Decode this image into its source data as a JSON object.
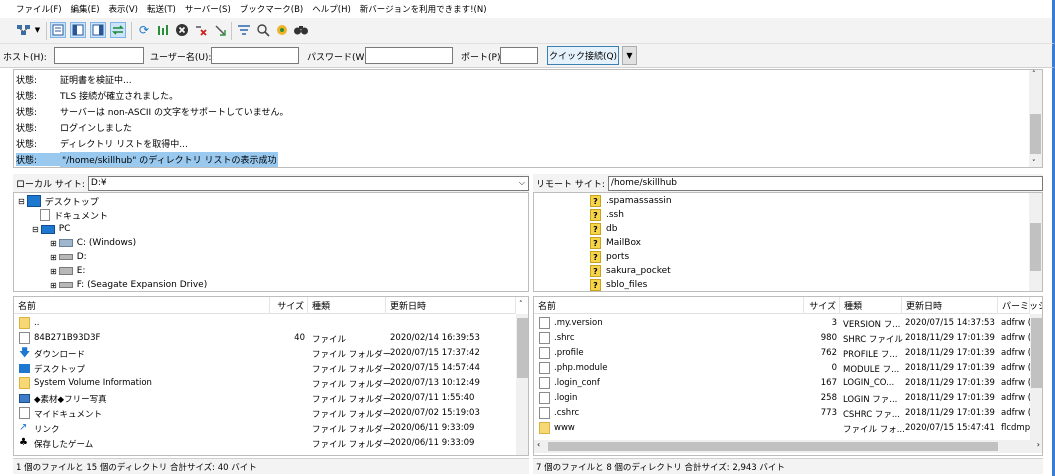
{
  "menu": [
    "ファイル(F)",
    "編集(E)",
    "表示(V)",
    "転送(T)",
    "サーバー(S)",
    "ブックマーク(B)",
    "ヘルプ(H)",
    "新バージョンを利用できます!(N)"
  ],
  "quickconnect": {
    "host_label": "ホスト(H):",
    "user_label": "ユーザー名(U):",
    "pass_label": "パスワード(W):",
    "port_label": "ポート(P):",
    "button": "クイック接続(Q)",
    "dropdown": "▼"
  },
  "log": {
    "rows": [
      {
        "k": "状態:",
        "v": "証明書を検証中..."
      },
      {
        "k": "状態:",
        "v": "TLS 接続が確立されました。"
      },
      {
        "k": "状態:",
        "v": "サーバーは non-ASCII の文字をサポートしていません。"
      },
      {
        "k": "状態:",
        "v": "ログインしました"
      },
      {
        "k": "状態:",
        "v": "ディレクトリ リストを取得中..."
      },
      {
        "k": "状態:",
        "v": "\"/home/skillhub\" のディレクトリ リストの表示成功"
      }
    ]
  },
  "local": {
    "site_label": "ローカル サイト:",
    "site_path": "D:¥",
    "tree": [
      {
        "label": "デスクトップ",
        "icon": "desktop-icon"
      },
      {
        "label": "ドキュメント",
        "icon": "document-icon"
      },
      {
        "label": "PC",
        "icon": "pc-icon"
      },
      {
        "label": "C: (Windows)",
        "icon": "drive-icon"
      },
      {
        "label": "D:",
        "icon": "drive-icon"
      },
      {
        "label": "E:",
        "icon": "drive-icon"
      },
      {
        "label": "F: (Seagate Expansion Drive)",
        "icon": "drive-icon"
      }
    ],
    "columns": [
      "名前",
      "サイズ",
      "種類",
      "更新日時"
    ],
    "rows": [
      {
        "name": "..",
        "size": "",
        "type": "",
        "date": "",
        "icon": "folder"
      },
      {
        "name": "84B271B93D3F",
        "size": "40",
        "type": "ファイル",
        "date": "2020/02/14 16:39:53",
        "icon": "file"
      },
      {
        "name": "ダウンロード",
        "size": "",
        "type": "ファイル フォルダー",
        "date": "2020/07/15 17:37:42",
        "icon": "download"
      },
      {
        "name": "デスクトップ",
        "size": "",
        "type": "ファイル フォルダー",
        "date": "2020/07/15 14:57:44",
        "icon": "desktop"
      },
      {
        "name": "System Volume Information",
        "size": "",
        "type": "ファイル フォルダー",
        "date": "2020/07/13 10:12:49",
        "icon": "folder"
      },
      {
        "name": "◆素材◆フリー写真",
        "size": "",
        "type": "ファイル フォルダー",
        "date": "2020/07/11 1:55:40",
        "icon": "folder"
      },
      {
        "name": "マイドキュメント",
        "size": "",
        "type": "ファイル フォルダー",
        "date": "2020/07/02 15:19:03",
        "icon": "document"
      },
      {
        "name": "リンク",
        "size": "",
        "type": "ファイル フォルダー",
        "date": "2020/06/11 9:33:09",
        "icon": "link"
      },
      {
        "name": "保存したゲーム",
        "size": "",
        "type": "ファイル フォルダー",
        "date": "2020/06/11 9:33:09",
        "icon": "game"
      }
    ],
    "status": "1 個のファイルと 15 個のディレクトリ 合計サイズ: 40 バイト"
  },
  "remote": {
    "site_label": "リモート サイト:",
    "site_path": "/home/skillhub",
    "tree": [
      ".spamassassin",
      ".ssh",
      "db",
      "MailBox",
      "ports",
      "sakura_pocket",
      "sblo_files"
    ],
    "columns": [
      "名前",
      "サイズ",
      "種類",
      "更新日時",
      "パーミッシ"
    ],
    "rows": [
      {
        "name": ".my.version",
        "size": "3",
        "type": "VERSION フ...",
        "date": "2020/07/15 14:37:53",
        "perm": "adfrw (",
        "icon": "file"
      },
      {
        "name": ".shrc",
        "size": "980",
        "type": "SHRC ファイル",
        "date": "2018/11/29 17:01:39",
        "perm": "adfrw (",
        "icon": "file"
      },
      {
        "name": ".profile",
        "size": "762",
        "type": "PROFILE フ...",
        "date": "2018/11/29 17:01:39",
        "perm": "adfrw (",
        "icon": "file"
      },
      {
        "name": ".php.module",
        "size": "0",
        "type": "MODULE フ...",
        "date": "2018/11/29 17:01:39",
        "perm": "adfrw (",
        "icon": "file"
      },
      {
        "name": ".login_conf",
        "size": "167",
        "type": "LOGIN_CO...",
        "date": "2018/11/29 17:01:39",
        "perm": "adfrw (",
        "icon": "file"
      },
      {
        "name": ".login",
        "size": "258",
        "type": "LOGIN ファ...",
        "date": "2018/11/29 17:01:39",
        "perm": "adfrw (",
        "icon": "file"
      },
      {
        "name": ".cshrc",
        "size": "773",
        "type": "CSHRC ファ...",
        "date": "2018/11/29 17:01:39",
        "perm": "adfrw (",
        "icon": "file"
      },
      {
        "name": "www",
        "size": "",
        "type": "ファイル フォ...",
        "date": "2020/07/15 15:47:41",
        "perm": "flcdmp",
        "icon": "folder"
      }
    ],
    "status": "7 個のファイルと 8 個のディレクトリ 合計サイズ: 2,943 バイト"
  },
  "colors": {
    "accent": "#3b7bd4",
    "selection": "#99c9ef",
    "folder": "#f8d775"
  }
}
